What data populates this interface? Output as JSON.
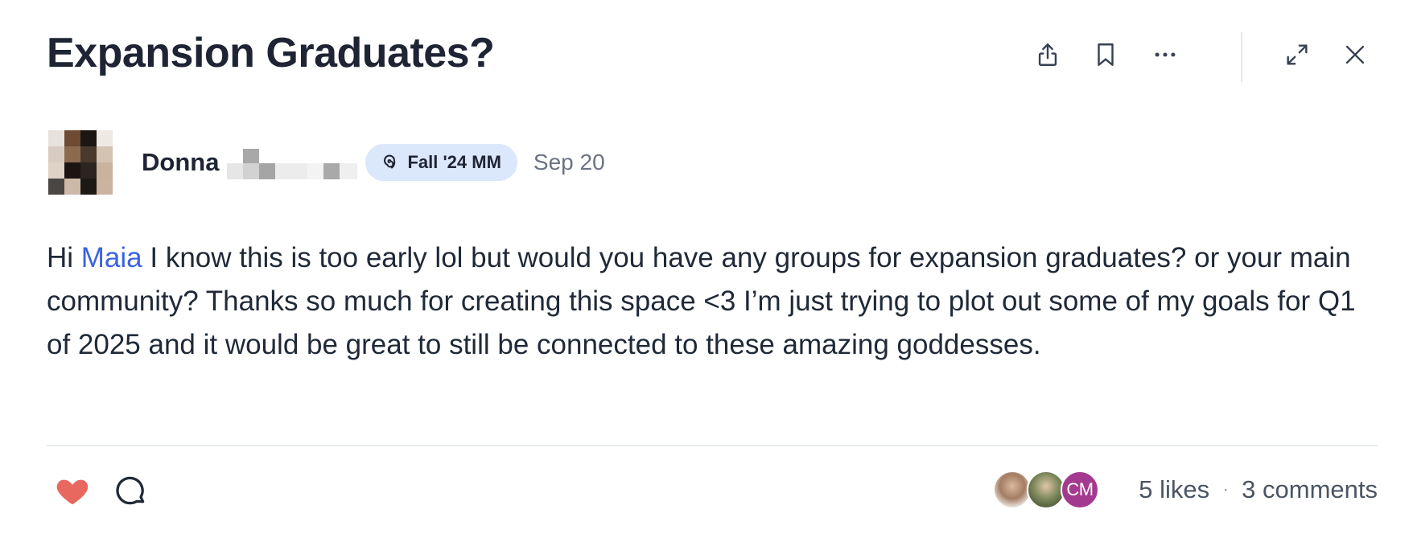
{
  "post": {
    "title": "Expansion Graduates?",
    "author": {
      "first_name": "Donna",
      "badge_label": "Fall '24 MM",
      "date": "Sep 20"
    },
    "body": {
      "greeting": "Hi ",
      "mention": "Maia",
      "text": " I know this is too early lol but would you have any groups for expansion graduates? or your main community? Thanks so much for creating this space <3 I’m just trying to plot out some of my goals for Q1 of 2025 and it would be great to still be connected to these amazing goddesses."
    },
    "toolbar": {
      "icons": [
        "share-icon",
        "bookmark-icon",
        "more-options-icon",
        "expand-icon",
        "close-icon"
      ]
    },
    "footer": {
      "likers": [
        {
          "type": "photo"
        },
        {
          "type": "photo"
        },
        {
          "type": "initials",
          "initials": "CM",
          "color": "#a43a8f"
        }
      ],
      "likes_label": "5 likes",
      "separator": "·",
      "comments_label": "3 comments"
    }
  },
  "colors": {
    "heart": "#e8685f",
    "mention": "#3b63e0",
    "badge_bg": "#dbe7fb"
  }
}
